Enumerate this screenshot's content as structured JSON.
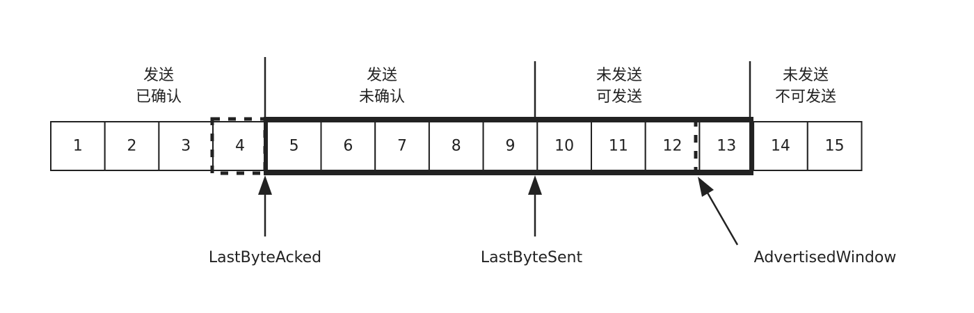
{
  "segments": [
    {
      "line1": "发送",
      "line2": "已确认"
    },
    {
      "line1": "发送",
      "line2": "未确认"
    },
    {
      "line1": "未发送",
      "line2": "可发送"
    },
    {
      "line1": "未发送",
      "line2": "不可发送"
    }
  ],
  "cells": [
    "1",
    "2",
    "3",
    "4",
    "5",
    "6",
    "7",
    "8",
    "9",
    "10",
    "11",
    "12",
    "13",
    "14",
    "15"
  ],
  "pointers": {
    "last_byte_acked": "LastByteAcked",
    "last_byte_sent": "LastByteSent",
    "advertised_window": "AdvertisedWindow"
  },
  "colors": {
    "stroke": "#222222",
    "background": "#ffffff"
  }
}
